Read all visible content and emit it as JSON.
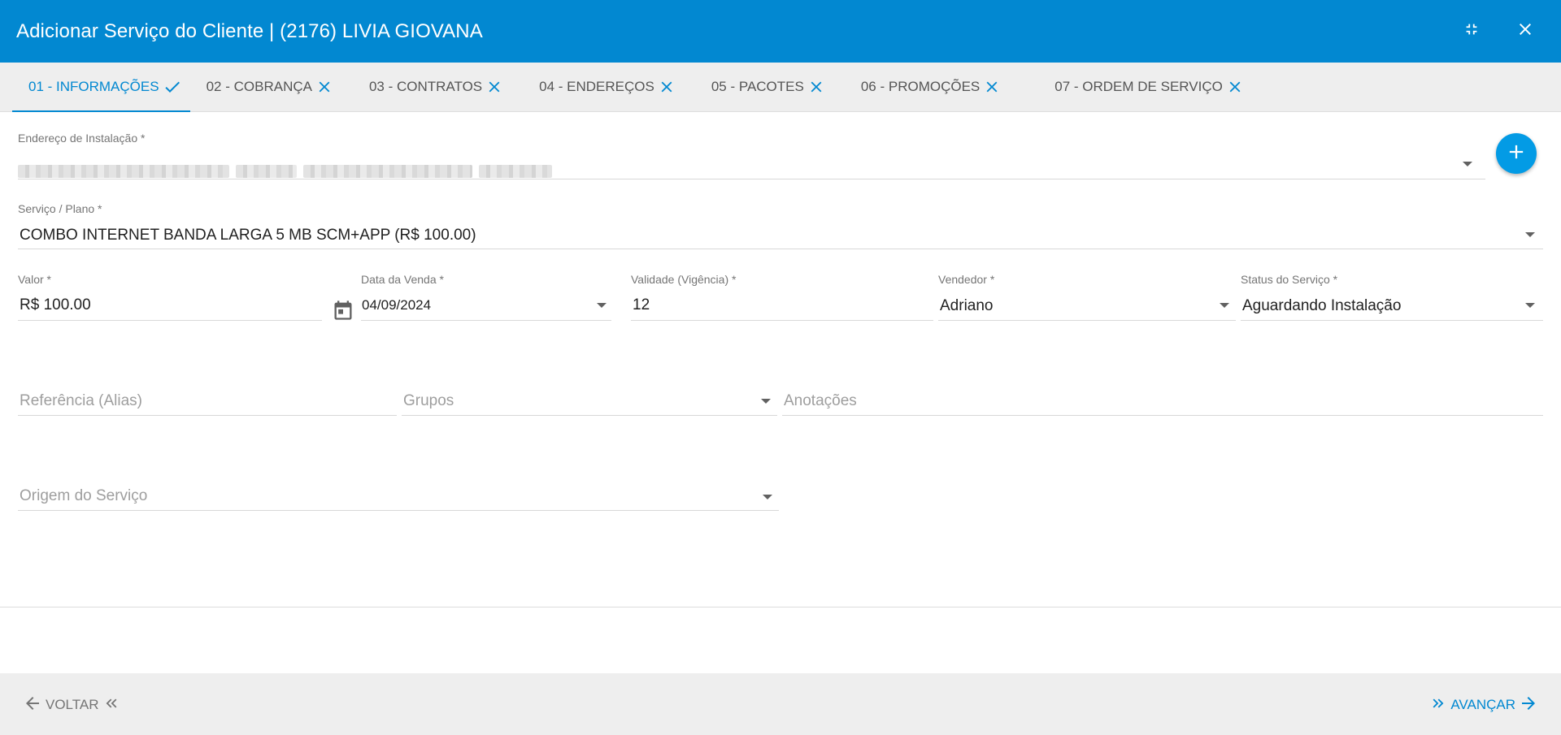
{
  "dialog": {
    "title": "Adicionar Serviço do Cliente | (2176) LIVIA GIOVANA",
    "header_color": "#0288d1"
  },
  "tabs": [
    {
      "label": "01 - INFORMAÇÕES",
      "status": "check",
      "active": true
    },
    {
      "label": "02 - COBRANÇA",
      "status": "close",
      "active": false
    },
    {
      "label": "03 - CONTRATOS",
      "status": "close",
      "active": false
    },
    {
      "label": "04 - ENDEREÇOS",
      "status": "close",
      "active": false
    },
    {
      "label": "05 - PACOTES",
      "status": "close",
      "active": false
    },
    {
      "label": "06 - PROMOÇÕES",
      "status": "close",
      "active": false
    },
    {
      "label": "07 - ORDEM DE SERVIÇO",
      "status": "close",
      "active": false
    }
  ],
  "form": {
    "endereco": {
      "label": "Endereço de Instalação *"
    },
    "servico": {
      "label": "Serviço / Plano *",
      "value": "COMBO INTERNET BANDA LARGA 5 MB SCM+APP (R$ 100.00)"
    },
    "valor": {
      "label": "Valor *",
      "value": "R$ 100.00"
    },
    "data_venda": {
      "label": "Data da Venda *",
      "value": "04/09/2024"
    },
    "validade": {
      "label": "Validade (Vigência) *",
      "value": "12"
    },
    "vendedor": {
      "label": "Vendedor *",
      "value": "Adriano"
    },
    "status": {
      "label": "Status do Serviço *",
      "value": "Aguardando Instalação"
    },
    "referencia": {
      "placeholder": "Referência (Alias)"
    },
    "grupos": {
      "placeholder": "Grupos"
    },
    "anotacoes": {
      "placeholder": "Anotações"
    },
    "origem": {
      "placeholder": "Origem do Serviço"
    }
  },
  "footer": {
    "back_label": "VOLTAR",
    "next_label": "AVANÇAR"
  }
}
